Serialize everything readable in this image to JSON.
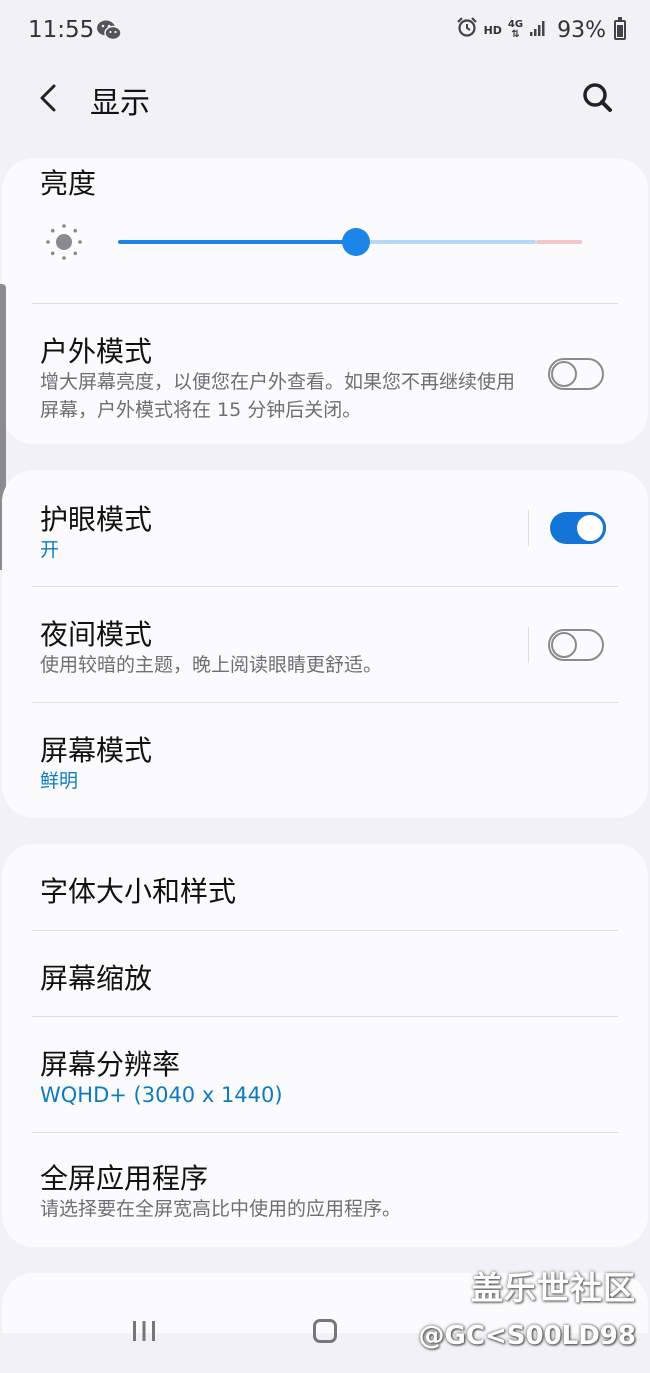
{
  "status_bar": {
    "time": "11:55",
    "hd_label": "HD",
    "net_label": "4G",
    "battery_pct": "93%",
    "icons": [
      "wechat-icon",
      "alarm-icon",
      "signal-icon",
      "battery-icon"
    ]
  },
  "app_bar": {
    "title": "显示",
    "icons": [
      "back-icon",
      "search-icon"
    ]
  },
  "brightness": {
    "title": "亮度",
    "level_fraction": 0.51,
    "icon": "sun-icon"
  },
  "outdoor_mode": {
    "title": "户外模式",
    "description": "增大屏幕亮度，以便您在户外查看。如果您不再继续使用屏幕，户外模式将在 15 分钟后关闭。",
    "enabled": false
  },
  "eye_comfort": {
    "title": "护眼模式",
    "status": "开",
    "enabled": true
  },
  "night_mode": {
    "title": "夜间模式",
    "description": "使用较暗的主题，晚上阅读眼睛更舒适。",
    "enabled": false
  },
  "screen_mode": {
    "title": "屏幕模式",
    "value": "鲜明"
  },
  "font_size_style": {
    "title": "字体大小和样式"
  },
  "screen_zoom": {
    "title": "屏幕缩放"
  },
  "screen_resolution": {
    "title": "屏幕分辨率",
    "value": "WQHD+ (3040 x 1440)"
  },
  "full_screen_apps": {
    "title": "全屏应用程序",
    "description": "请选择要在全屏宽高比中使用的应用程序。"
  },
  "watermark": {
    "line1": "盖乐世社区",
    "line2": "@GC<S00LD98"
  },
  "colors": {
    "accent": "#1474d8",
    "value_text": "#0d7bc4",
    "background": "#f2f1f6",
    "card": "#fbfbfd"
  }
}
